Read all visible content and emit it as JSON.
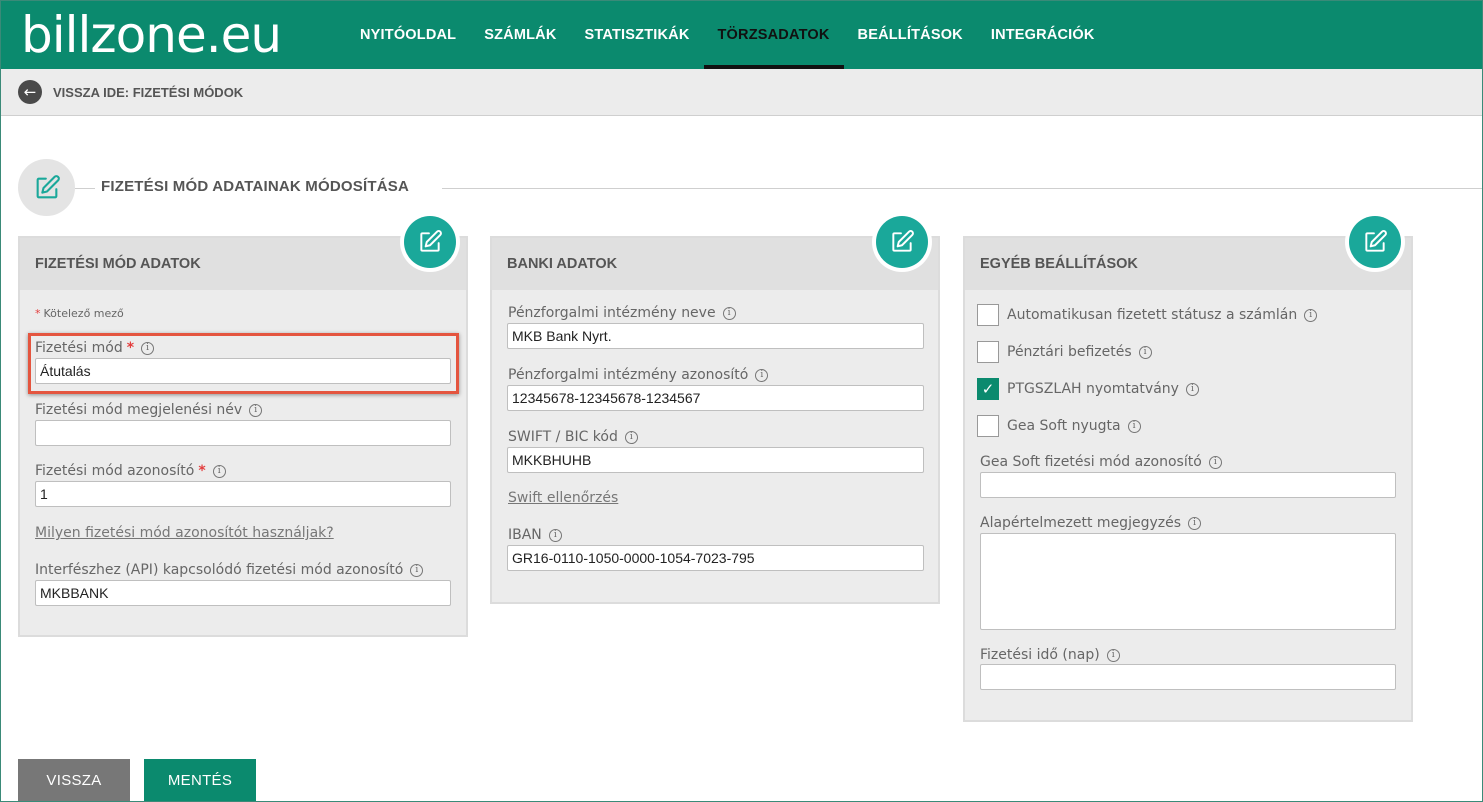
{
  "brand": {
    "logo_text": "billzone.eu",
    "primary_color": "#0b8a6e",
    "accent_color": "#1aa89a"
  },
  "nav": {
    "items": [
      {
        "label": "NYITÓOLDAL",
        "active": false
      },
      {
        "label": "SZÁMLÁK",
        "active": false
      },
      {
        "label": "STATISZTIKÁK",
        "active": false
      },
      {
        "label": "TÖRZSADATOK",
        "active": true
      },
      {
        "label": "BEÁLLÍTÁSOK",
        "active": false
      },
      {
        "label": "INTEGRÁCIÓK",
        "active": false
      }
    ]
  },
  "backbar": {
    "label": "VISSZA IDE: FIZETÉSI MÓDOK"
  },
  "section": {
    "title": "FIZETÉSI MÓD ADATAINAK MÓDOSÍTÁSA"
  },
  "panel_payment": {
    "title": "FIZETÉSI MÓD ADATOK",
    "required_note": "Kötelező mező",
    "method_label": "Fizetési mód",
    "method_value": "Átutalás",
    "display_name_label": "Fizetési mód megjelenési név",
    "display_name_value": "",
    "id_label": "Fizetési mód azonosító",
    "id_value": "1",
    "help_link": "Milyen fizetési mód azonosítót használjak?",
    "api_label": "Interfészhez (API) kapcsolódó fizetési mód azonosító",
    "api_value": "MKBBANK"
  },
  "panel_bank": {
    "title": "BANKI ADATOK",
    "bank_name_label": "Pénzforgalmi intézmény neve",
    "bank_name_value": "MKB Bank Nyrt.",
    "bank_id_label": "Pénzforgalmi intézmény azonosító",
    "bank_id_value": "12345678-12345678-1234567",
    "swift_label": "SWIFT / BIC kód",
    "swift_value": "MKKBHUHB",
    "swift_check_link": "Swift ellenőrzés",
    "iban_label": "IBAN",
    "iban_value": "GR16-0110-1050-0000-1054-7023-795"
  },
  "panel_other": {
    "title": "EGYÉB BEÁLLÍTÁSOK",
    "checkboxes": [
      {
        "label": "Automatikusan fizetett státusz a számlán",
        "checked": false
      },
      {
        "label": "Pénztári befizetés",
        "checked": false
      },
      {
        "label": "PTGSZLAH nyomtatvány",
        "checked": true
      },
      {
        "label": "Gea Soft nyugta",
        "checked": false
      }
    ],
    "gea_id_label": "Gea Soft fizetési mód azonosító",
    "gea_id_value": "",
    "default_note_label": "Alapértelmezett megjegyzés",
    "payment_days_label": "Fizetési idő (nap)",
    "payment_days_value": ""
  },
  "buttons": {
    "back": "VISSZA",
    "save": "MENTÉS"
  },
  "icons": {
    "info": "i",
    "back_arrow": "←",
    "check": "✓"
  }
}
